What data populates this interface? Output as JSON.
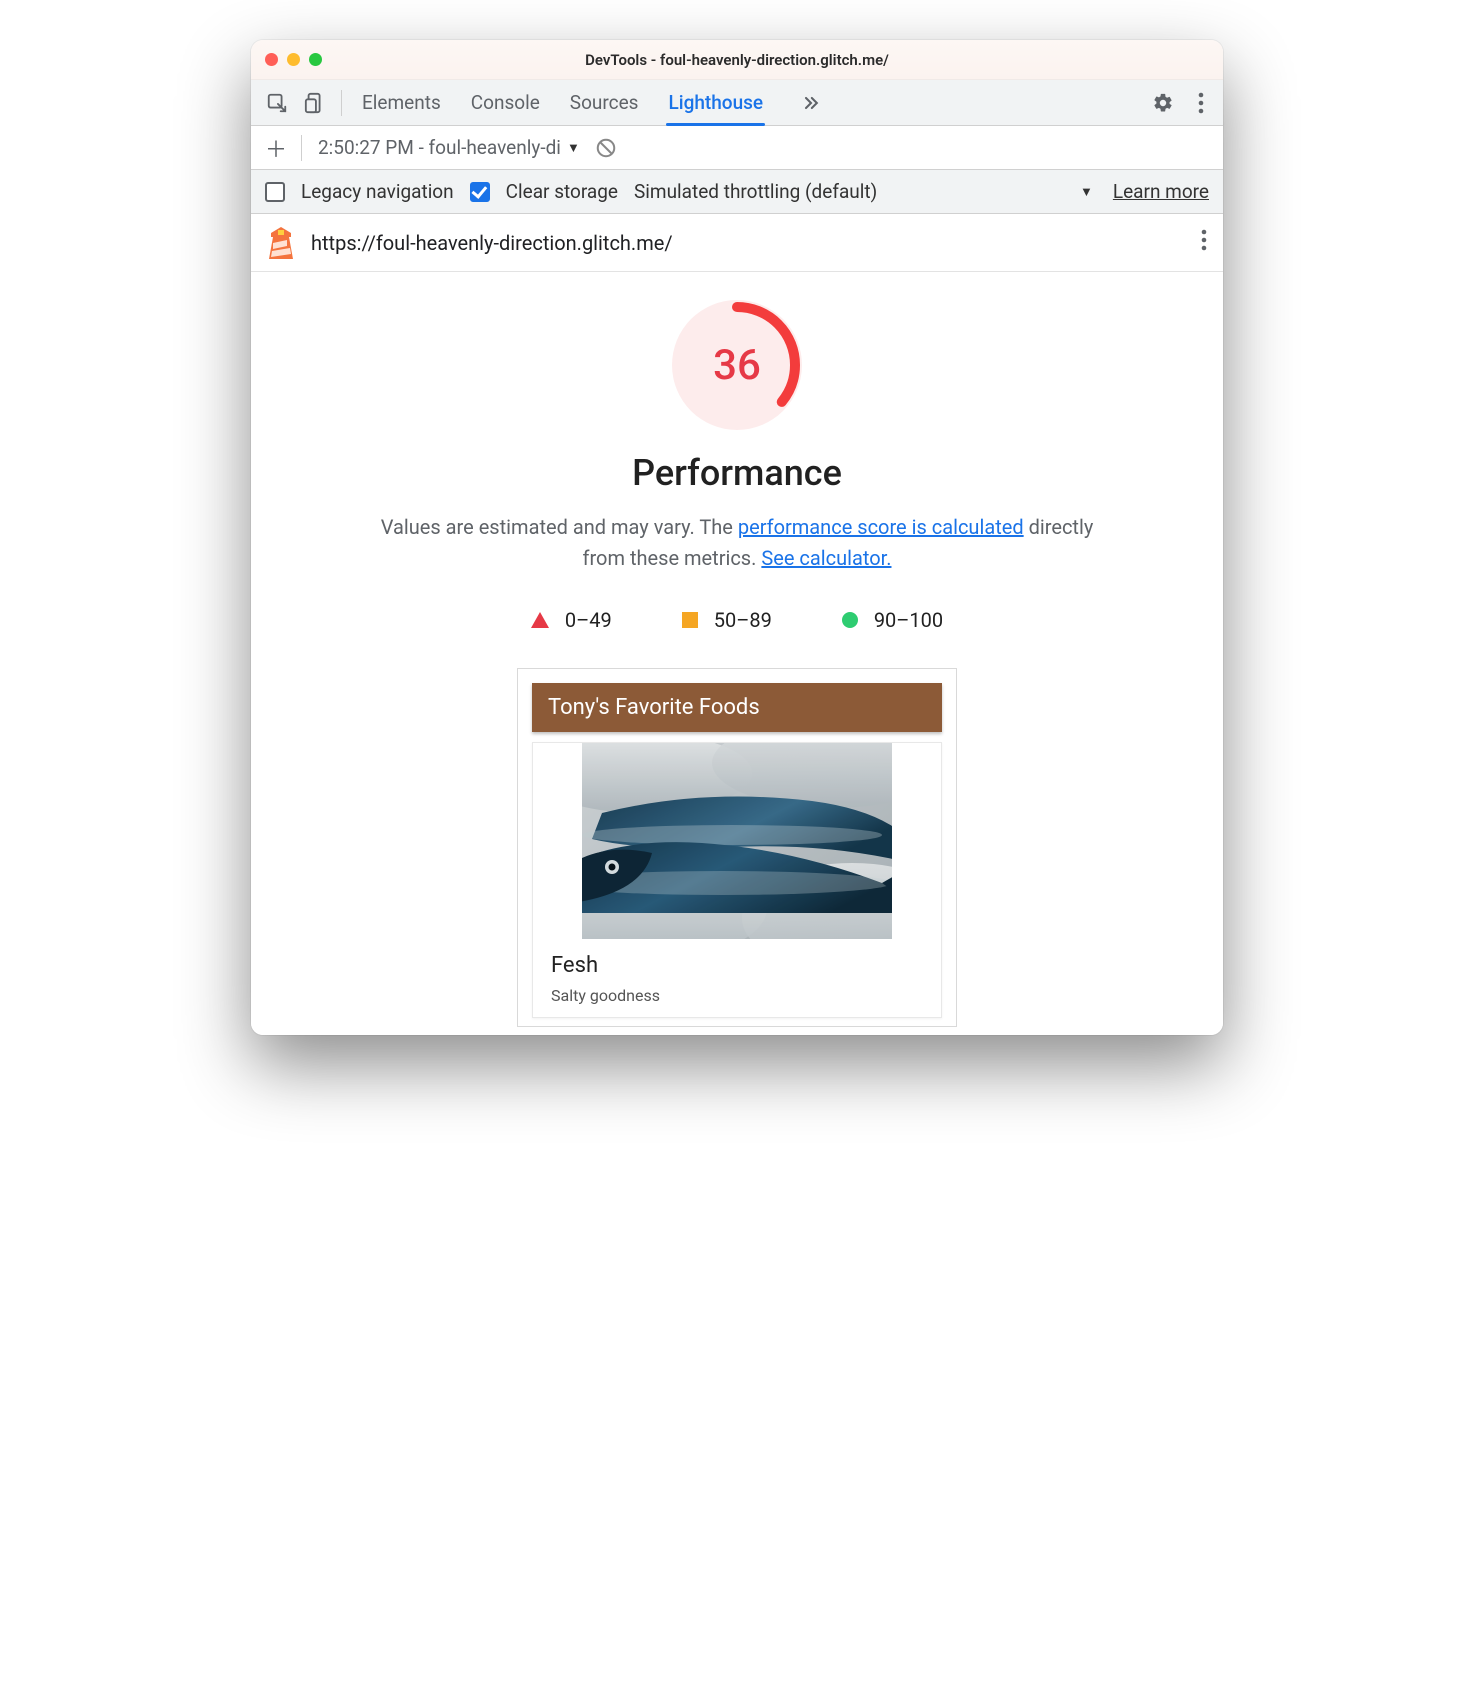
{
  "window": {
    "title": "DevTools - foul-heavenly-direction.glitch.me/"
  },
  "tabs": {
    "items": [
      "Elements",
      "Console",
      "Sources",
      "Lighthouse"
    ],
    "active": "Lighthouse"
  },
  "subtoolbar": {
    "run_label": "2:50:27 PM - foul-heavenly-di"
  },
  "options": {
    "legacy_label": "Legacy navigation",
    "legacy_checked": false,
    "clear_label": "Clear storage",
    "clear_checked": true,
    "throttling_label": "Simulated throttling (default)",
    "learn_more": "Learn more"
  },
  "urlbar": {
    "url": "https://foul-heavenly-direction.glitch.me/"
  },
  "report": {
    "score": "36",
    "score_color": "#e63946",
    "category": "Performance",
    "desc_prefix": "Values are estimated and may vary. The ",
    "desc_link1": "performance score is calculated",
    "desc_mid": " directly from these metrics. ",
    "desc_link2": "See calculator.",
    "legend": {
      "low": "0–49",
      "mid": "50–89",
      "high": "90–100"
    }
  },
  "preview": {
    "header": "Tony's Favorite Foods",
    "item_title": "Fesh",
    "item_sub": "Salty goodness"
  }
}
